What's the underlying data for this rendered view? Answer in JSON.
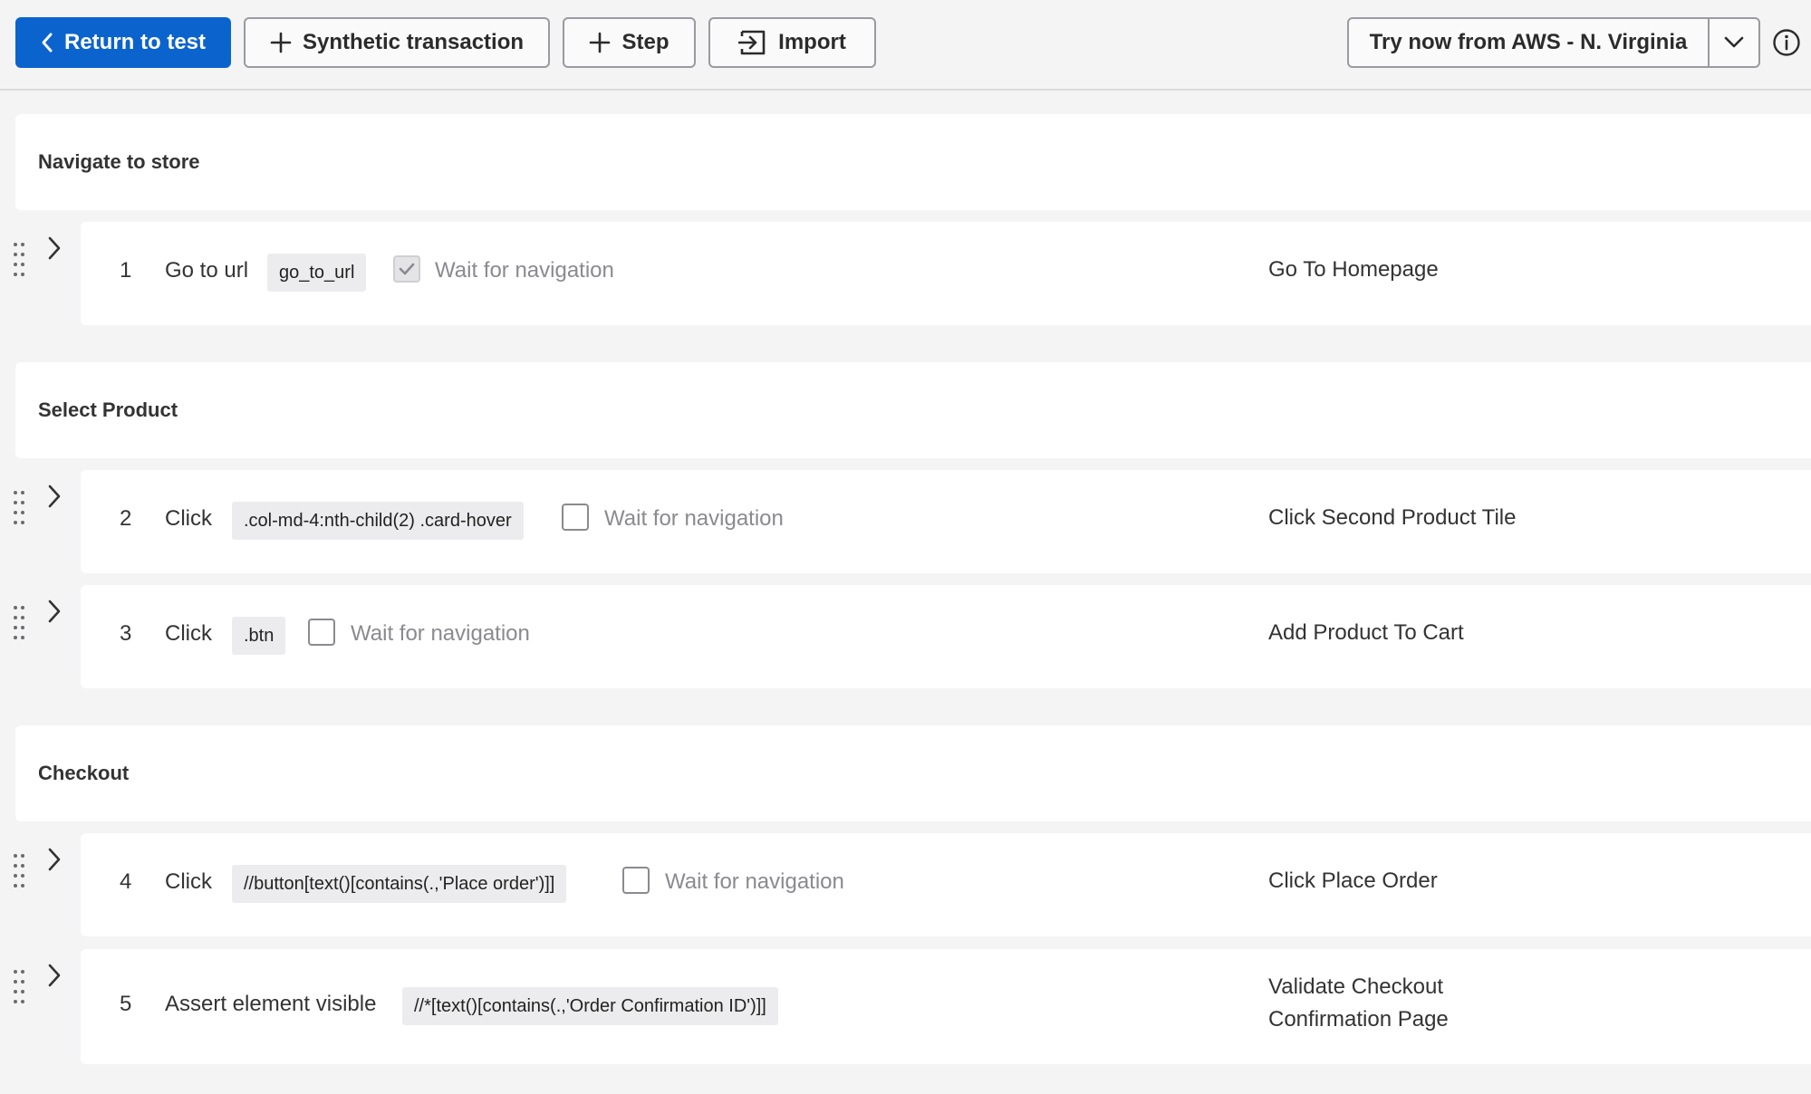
{
  "toolbar": {
    "return_label": "Return to test",
    "synthetic_label": "Synthetic transaction",
    "step_label": "Step",
    "import_label": "Import",
    "try_now_label": "Try now from AWS - N. Virginia"
  },
  "sections": [
    {
      "title": "Navigate to store"
    },
    {
      "title": "Select Product"
    },
    {
      "title": "Checkout"
    }
  ],
  "steps": [
    {
      "num": "1",
      "action": "Go to url",
      "selector": "go_to_url",
      "wait_label": "Wait for navigation",
      "wait_checked": true,
      "description": "Go To Homepage"
    },
    {
      "num": "2",
      "action": "Click",
      "selector": ".col-md-4:nth-child(2) .card-hover",
      "wait_label": "Wait for navigation",
      "wait_checked": false,
      "description": "Click Second Product Tile"
    },
    {
      "num": "3",
      "action": "Click",
      "selector": ".btn",
      "wait_label": "Wait for navigation",
      "wait_checked": false,
      "description": "Add Product To Cart"
    },
    {
      "num": "4",
      "action": "Click",
      "selector": "//button[text()[contains(.,'Place order')]]",
      "wait_label": "Wait for navigation",
      "wait_checked": false,
      "description": "Click Place Order"
    },
    {
      "num": "5",
      "action": "Assert element visible",
      "selector": "//*[text()[contains(.,'Order Confirmation ID')]]",
      "description_line1": "Validate Checkout",
      "description_line2": "Confirmation Page"
    }
  ],
  "colors": {
    "primary": "#0b63ce",
    "background": "#f4f4f5",
    "card": "#ffffff"
  },
  "icons": [
    "chevron-left-icon",
    "plus-icon",
    "import-icon",
    "chevron-down-icon",
    "info-icon",
    "drag-handle-icon",
    "chevron-right-icon",
    "checkmark-icon"
  ]
}
